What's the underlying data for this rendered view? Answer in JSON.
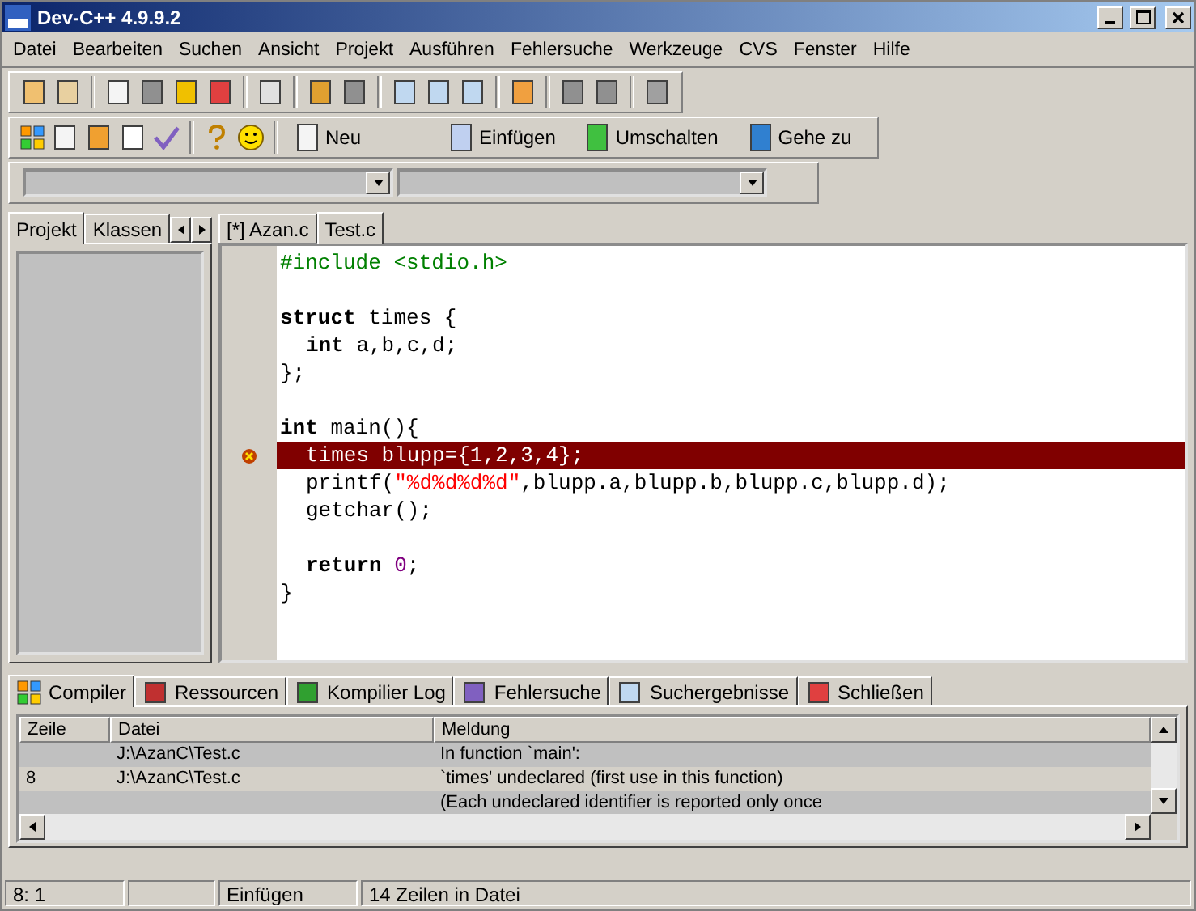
{
  "window": {
    "title": "Dev-C++ 4.9.9.2"
  },
  "menu": [
    "Datei",
    "Bearbeiten",
    "Suchen",
    "Ansicht",
    "Projekt",
    "Ausführen",
    "Fehlersuche",
    "Werkzeuge",
    "CVS",
    "Fenster",
    "Hilfe"
  ],
  "toolbar_buttons": [
    "Neu",
    "Einfügen",
    "Umschalten",
    "Gehe zu"
  ],
  "side_tabs": [
    {
      "label": "Projekt",
      "selected": true
    },
    {
      "label": "Klassen",
      "selected": false
    }
  ],
  "editor_tabs": [
    {
      "label": "[*] Azan.c",
      "selected": false
    },
    {
      "label": "Test.c",
      "selected": true
    }
  ],
  "code": [
    {
      "error": false,
      "indent": false,
      "tokens": [
        {
          "kind": "preproc",
          "text": "#include <stdio.h>"
        }
      ]
    },
    {
      "error": false
    },
    {
      "error": false,
      "indent": false,
      "tokens": [
        {
          "kind": "keyword",
          "text": "struct"
        },
        {
          "kind": "plain",
          "text": " times {"
        }
      ]
    },
    {
      "error": false,
      "indent": true,
      "tokens": [
        {
          "kind": "keyword",
          "text": "int"
        },
        {
          "kind": "plain",
          "text": " a,b,c,d;"
        }
      ]
    },
    {
      "error": false,
      "indent": false,
      "tokens": [
        {
          "kind": "plain",
          "text": "};"
        }
      ]
    },
    {
      "error": false
    },
    {
      "error": false,
      "indent": false,
      "tokens": [
        {
          "kind": "keyword",
          "text": "int"
        },
        {
          "kind": "plain",
          "text": " main(){"
        }
      ]
    },
    {
      "error": true,
      "indent": true,
      "tokens": [
        {
          "kind": "plain",
          "text": "times blupp={1,2,3,4};"
        }
      ]
    },
    {
      "error": false,
      "indent": true,
      "tokens": [
        {
          "kind": "plain",
          "text": "printf("
        },
        {
          "kind": "string",
          "text": "\"%d%d%d%d\""
        },
        {
          "kind": "plain",
          "text": ",blupp.a,blupp.b,blupp.c,blupp.d);"
        }
      ]
    },
    {
      "error": false,
      "indent": true,
      "tokens": [
        {
          "kind": "plain",
          "text": "getchar();"
        }
      ]
    },
    {
      "error": false
    },
    {
      "error": false,
      "indent": true,
      "tokens": [
        {
          "kind": "keyword",
          "text": "return"
        },
        {
          "kind": "number",
          "text": " 0"
        },
        {
          "kind": "plain",
          "text": ";"
        }
      ]
    },
    {
      "error": false,
      "indent": false,
      "tokens": [
        {
          "kind": "plain",
          "text": "}"
        }
      ]
    }
  ],
  "bottom_tabs": [
    {
      "label": "Compiler",
      "selected": true
    },
    {
      "label": "Ressourcen",
      "selected": false
    },
    {
      "label": "Kompilier Log",
      "selected": false
    },
    {
      "label": "Fehlersuche",
      "selected": false
    },
    {
      "label": "Suchergebnisse",
      "selected": false
    },
    {
      "label": "Schließen",
      "selected": false
    }
  ],
  "messages": {
    "columns": [
      "Zeile",
      "Datei",
      "Meldung"
    ],
    "rows": [
      {
        "line": "",
        "file": "J:\\AzanC\\Test.c",
        "message": "In function `main':"
      },
      {
        "line": "8",
        "file": "J:\\AzanC\\Test.c",
        "message": "`times' undeclared (first use in this function)"
      },
      {
        "line": "",
        "file": "",
        "message": "(Each undeclared identifier is reported only once"
      }
    ]
  },
  "status_bar": [
    "8: 1",
    "Einfügen",
    "14 Zeilen in Datei"
  ]
}
